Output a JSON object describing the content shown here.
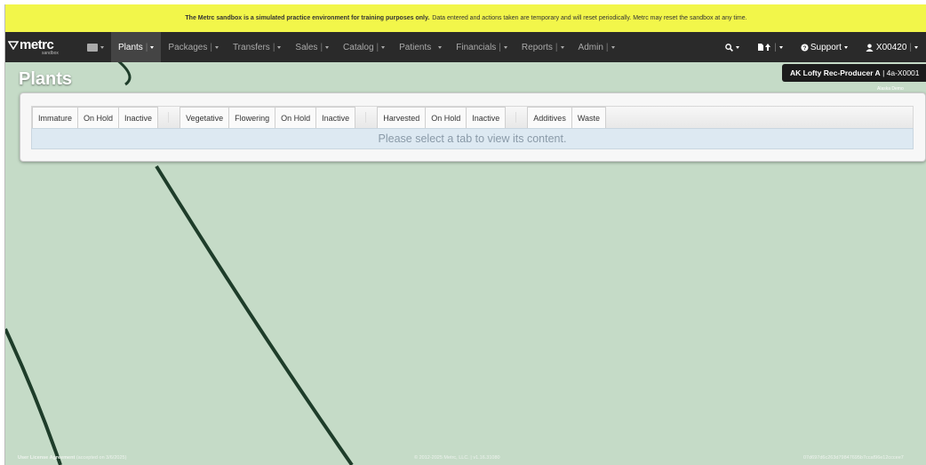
{
  "banner": {
    "bold_text": "The Metrc sandbox is a simulated practice environment for training purposes only.",
    "text": "Data entered and actions taken are temporary and will reset periodically. Metrc may reset the sandbox at any time."
  },
  "logo": {
    "word": "metrc",
    "sub": "sandbox"
  },
  "nav": {
    "items": [
      {
        "label": "Plants"
      },
      {
        "label": "Packages"
      },
      {
        "label": "Transfers"
      },
      {
        "label": "Sales"
      },
      {
        "label": "Catalog"
      },
      {
        "label": "Patients"
      },
      {
        "label": "Financials"
      },
      {
        "label": "Reports"
      },
      {
        "label": "Admin"
      }
    ],
    "support_label": "Support",
    "user_label": "X00420"
  },
  "page": {
    "title": "Plants"
  },
  "facility": {
    "name": "AK Lofty Rec-Producer A",
    "license": "| 4a-X0001",
    "sub": "Alaska Demo"
  },
  "tabs": {
    "group1": [
      "Immature",
      "On Hold",
      "Inactive"
    ],
    "group2": [
      "Vegetative",
      "Flowering",
      "On Hold",
      "Inactive"
    ],
    "group3": [
      "Harvested",
      "On Hold",
      "Inactive"
    ],
    "group4": [
      "Additives",
      "Waste"
    ],
    "placeholder": "Please select a tab to view its content."
  },
  "footer": {
    "license_label": "User License Agreement",
    "license_note": "(accepted on 3/6/2025)",
    "copyright": "© 2012-2025 Metrc, LLC. | v1.16.31080",
    "hash": "07d697d6c263d79847695b7ccaf96e12cccee7"
  },
  "colors": {
    "banner": "#f2f64a",
    "navbar": "#2a2a2a",
    "background": "#c5dbc7",
    "curve": "#1e3d2a"
  }
}
